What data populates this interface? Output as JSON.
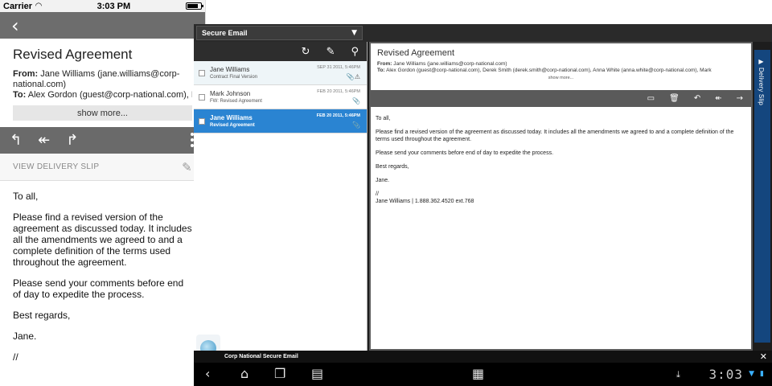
{
  "phone": {
    "status": {
      "carrier": "Carrier",
      "time": "3:03 PM",
      "battery_level": 0.8
    },
    "nav": {
      "back_icon": "chevron-left-icon"
    },
    "email": {
      "subject": "Revised Agreement",
      "from_label": "From:",
      "from_value": "Jane Williams (jane.williams@corp-national.com)",
      "to_label": "To:",
      "to_value": "Alex Gordon (guest@corp-national.com), Derek",
      "show_more": "show more..."
    },
    "actions": [
      "reply-icon",
      "reply-all-icon",
      "forward-icon",
      "more-icon"
    ],
    "delivery_slip": "VIEW DELIVERY SLIP",
    "body": [
      "To all,",
      "Please find a revised version of the agreement as discussed today. It includes all the amendments we agreed to and a complete definition of the terms used throughout the agreement.",
      "Please send your comments before end of day to expedite the process.",
      "Best regards,",
      "Jane.",
      "//"
    ]
  },
  "tablet": {
    "app_selector": "Secure Email",
    "list_toolbar": [
      "refresh-icon",
      "compose-icon",
      "search-icon"
    ],
    "messages": [
      {
        "from": "Jane Williams",
        "subject": "Contract Final Version",
        "date": "SEP 31 2011, 5:46PM",
        "attach": "📎⚠",
        "state": "unread"
      },
      {
        "from": "Mark Johnson",
        "subject": "FW: Revised Agreement",
        "date": "FEB 20 2011, 5:46PM",
        "attach": "📎",
        "state": "normal"
      },
      {
        "from": "Jane Williams",
        "subject": "Revised Agreement",
        "date": "FEB 20 2011, 5:46PM",
        "attach": "📎",
        "state": "selected"
      }
    ],
    "reader": {
      "subject": "Revised Agreement",
      "from_label": "From:",
      "from_value": "Jane Williams (jane.williams@corp-national.com)",
      "to_label": "To:",
      "to_value": "Alex Gordon (guest@corp-national.com), Derek Smith (derek.smith@corp-national.com), Anna White (anna.white@corp-national.com), Mark",
      "show_more": "show more...",
      "toolbar": [
        "folder-icon",
        "trash-icon",
        "reply-icon",
        "reply-all-icon",
        "forward-icon"
      ],
      "body": [
        "To all,",
        "Please find a revised version of the agreement as discussed today. It includes all the amendments we agreed to and a complete definition of the terms used throughout the agreement.",
        "Please send your comments before end of day to expedite the process.",
        "Best regards,",
        "Jane.",
        "//",
        "Jane Williams | 1.888.362.4520 ext.768"
      ]
    },
    "delivery_slip": "Delivery Slip",
    "footer_title": "Corp National Secure Email",
    "clock": "3:03"
  }
}
